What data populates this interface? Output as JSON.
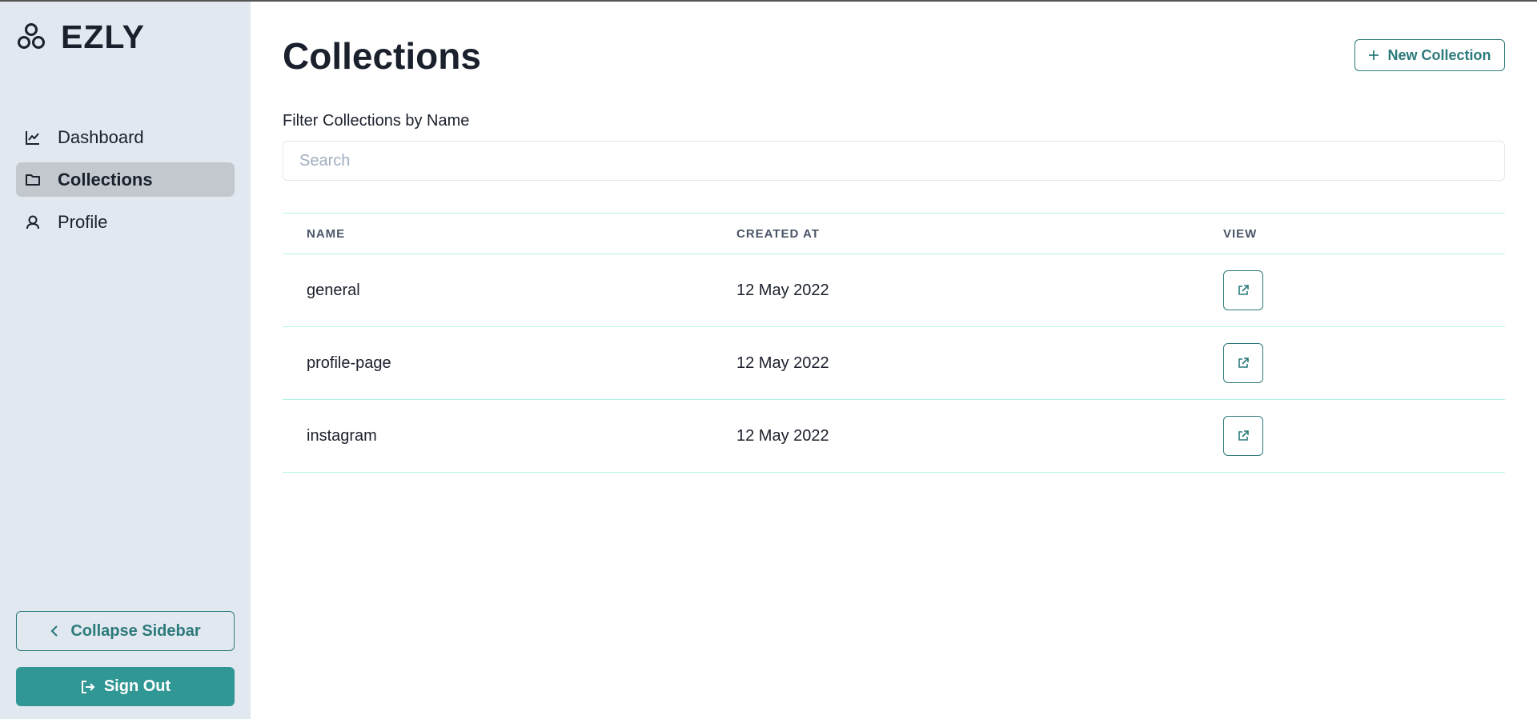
{
  "app": {
    "name": "EZLY",
    "logo_icon": "three-circles-logo-icon"
  },
  "sidebar": {
    "items": [
      {
        "label": "Dashboard",
        "icon": "chart-line-icon",
        "active": false
      },
      {
        "label": "Collections",
        "icon": "folder-icon",
        "active": true
      },
      {
        "label": "Profile",
        "icon": "user-icon",
        "active": false
      }
    ],
    "collapse_label": "Collapse Sidebar",
    "signout_label": "Sign Out"
  },
  "main": {
    "title": "Collections",
    "new_button_label": "New Collection",
    "filter_label": "Filter Collections by Name",
    "search": {
      "placeholder": "Search",
      "value": ""
    },
    "table": {
      "columns": [
        "NAME",
        "CREATED AT",
        "VIEW"
      ],
      "rows": [
        {
          "name": "general",
          "created_at": "12 May 2022"
        },
        {
          "name": "profile-page",
          "created_at": "12 May 2022"
        },
        {
          "name": "instagram",
          "created_at": "12 May 2022"
        }
      ]
    }
  },
  "colors": {
    "accent": "#2c7a7b",
    "signout_bg": "#319795",
    "sidebar_bg": "#e2e8f0",
    "active_item_bg": "#c3c8cf",
    "row_border": "#b2f5ea"
  }
}
